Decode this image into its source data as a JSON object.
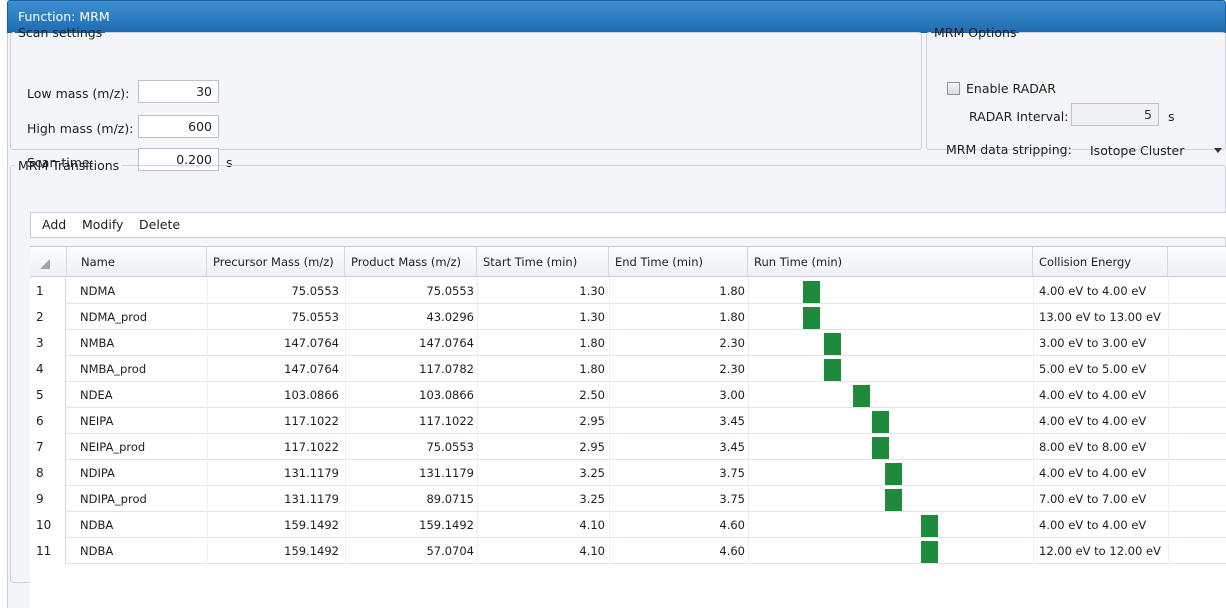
{
  "window": {
    "title": "Function: MRM"
  },
  "scan_settings": {
    "legend": "Scan settings",
    "low_mass_label": "Low mass (m/z):",
    "low_mass_value": "30",
    "high_mass_label": "High mass (m/z):",
    "high_mass_value": "600",
    "scan_time_label": "Scan time:",
    "scan_time_value": "0.200",
    "scan_time_unit": "s"
  },
  "mrm_options": {
    "legend": "MRM Options",
    "enable_radar_label": "Enable RADAR",
    "enable_radar_checked": false,
    "radar_interval_label": "RADAR Interval:",
    "radar_interval_value": "5",
    "radar_interval_unit": "s",
    "stripping_label": "MRM data stripping:",
    "stripping_value": "Isotope Cluster"
  },
  "transitions": {
    "legend": "MRM Transitions",
    "toolbar": {
      "add": "Add",
      "modify": "Modify",
      "delete": "Delete"
    },
    "columns": [
      "Name",
      "Precursor Mass (m/z)",
      "Product Mass (m/z)",
      "Start Time (min)",
      "End Time (min)",
      "Run Time (min)",
      "Collision Energy"
    ],
    "rows": [
      {
        "idx": "1",
        "name": "NDMA",
        "precursor": "75.0553",
        "product": "75.0553",
        "start": "1.30",
        "end": "1.80",
        "ce": "4.00 eV to 4.00 eV"
      },
      {
        "idx": "2",
        "name": "NDMA_prod",
        "precursor": "75.0553",
        "product": "43.0296",
        "start": "1.30",
        "end": "1.80",
        "ce": "13.00 eV to 13.00 eV"
      },
      {
        "idx": "3",
        "name": "NMBA",
        "precursor": "147.0764",
        "product": "147.0764",
        "start": "1.80",
        "end": "2.30",
        "ce": "3.00 eV to 3.00 eV"
      },
      {
        "idx": "4",
        "name": "NMBA_prod",
        "precursor": "147.0764",
        "product": "117.0782",
        "start": "1.80",
        "end": "2.30",
        "ce": "5.00 eV to 5.00 eV"
      },
      {
        "idx": "5",
        "name": "NDEA",
        "precursor": "103.0866",
        "product": "103.0866",
        "start": "2.50",
        "end": "3.00",
        "ce": "4.00 eV to 4.00 eV"
      },
      {
        "idx": "6",
        "name": "NEIPA",
        "precursor": "117.1022",
        "product": "117.1022",
        "start": "2.95",
        "end": "3.45",
        "ce": "4.00 eV to 4.00 eV"
      },
      {
        "idx": "7",
        "name": "NEIPA_prod",
        "precursor": "117.1022",
        "product": "75.0553",
        "start": "2.95",
        "end": "3.45",
        "ce": "8.00 eV to 8.00 eV"
      },
      {
        "idx": "8",
        "name": "NDIPA",
        "precursor": "131.1179",
        "product": "131.1179",
        "start": "3.25",
        "end": "3.75",
        "ce": "4.00 eV to 4.00 eV"
      },
      {
        "idx": "9",
        "name": "NDIPA_prod",
        "precursor": "131.1179",
        "product": "89.0715",
        "start": "3.25",
        "end": "3.75",
        "ce": "7.00 eV to 7.00 eV"
      },
      {
        "idx": "10",
        "name": "NDBA",
        "precursor": "159.1492",
        "product": "159.1492",
        "start": "4.10",
        "end": "4.60",
        "ce": "4.00 eV to 4.00 eV"
      },
      {
        "idx": "11",
        "name": "NDBA",
        "precursor": "159.1492",
        "product": "57.0704",
        "start": "4.10",
        "end": "4.60",
        "ce": "12.00 eV to 12.00 eV"
      }
    ]
  },
  "colors": {
    "title_bar": "#2a7cc2",
    "run_bar": "#1e8a3c"
  }
}
